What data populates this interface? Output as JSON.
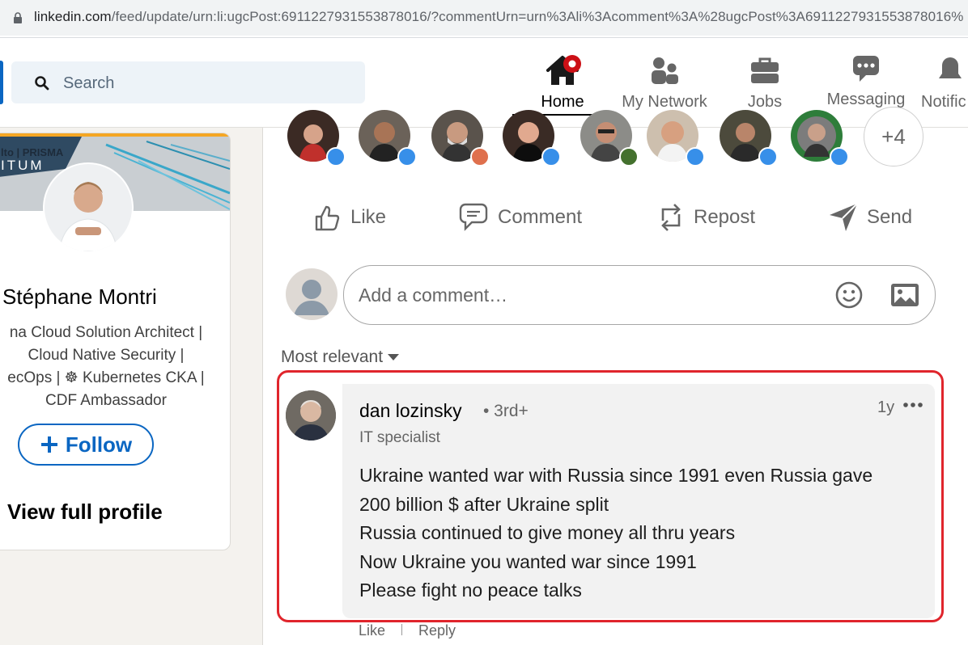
{
  "browser": {
    "url_host": "linkedin.com",
    "url_path": "/feed/update/urn:li:ugcPost:6911227931553878016/?commentUrn=urn%3Ali%3Acomment%3A%28ugcPost%3A6911227931553878016%"
  },
  "nav": {
    "search_placeholder": "Search",
    "items": [
      {
        "label": "Home",
        "icon": "home-icon",
        "active": true
      },
      {
        "label": "My Network",
        "icon": "network-icon"
      },
      {
        "label": "Jobs",
        "icon": "briefcase-icon"
      },
      {
        "label": "Messaging",
        "icon": "messaging-icon"
      },
      {
        "label": "Notific",
        "icon": "bell-icon"
      }
    ]
  },
  "profile": {
    "banner_brand": "lto | PRISMA",
    "banner_sub": "ITUM",
    "name": "Stéphane Montri",
    "headline_lines": [
      "na Cloud Solution Architect |",
      "Cloud Native Security |",
      "ecOps | ☸ Kubernetes CKA |",
      "CDF Ambassador"
    ],
    "follow_label": "Follow",
    "view_profile_label": "View full profile"
  },
  "post": {
    "more_reactors": "+4",
    "actions": {
      "like": "Like",
      "comment": "Comment",
      "repost": "Repost",
      "send": "Send"
    },
    "comment_placeholder": "Add a comment…",
    "sort_label": "Most relevant"
  },
  "comment": {
    "author": "dan lozinsky",
    "degree": "• 3rd+",
    "title": "IT specialist",
    "time": "1y",
    "body_lines": [
      "Ukraine wanted war with Russia since 1991 even Russia gave",
      "200 billion $ after Ukraine split",
      "Russia continued to give money all thru years",
      "Now Ukraine you wanted war since 1991",
      "Please fight no peace talks"
    ],
    "footer_like": "Like",
    "footer_reply": "Reply"
  },
  "colors": {
    "linkedin_blue": "#0a66c2",
    "highlight_red": "#e0252c",
    "notification_red": "#cc1016"
  }
}
